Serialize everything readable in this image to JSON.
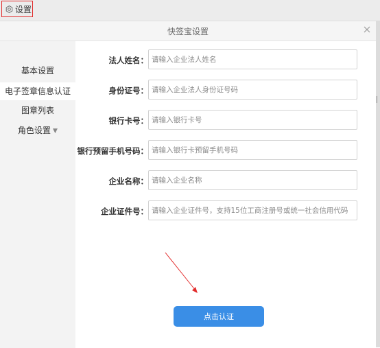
{
  "topbar": {
    "settings_label": "设置"
  },
  "dialog": {
    "title": "快签宝设置"
  },
  "sidebar": {
    "items": [
      {
        "label": "基本设置"
      },
      {
        "label": "电子签章信息认证"
      },
      {
        "label": "图章列表"
      },
      {
        "label": "角色设置"
      }
    ],
    "active_index": 1
  },
  "form": {
    "fields": [
      {
        "label": "法人姓名：",
        "placeholder": "请输入企业法人姓名",
        "value": ""
      },
      {
        "label": "身份证号：",
        "placeholder": "请输入企业法人身份证号码",
        "value": ""
      },
      {
        "label": "银行卡号：",
        "placeholder": "请输入银行卡号",
        "value": ""
      },
      {
        "label": "银行预留手机号码：",
        "placeholder": "请输入银行卡预留手机号码",
        "value": ""
      },
      {
        "label": "企业名称：",
        "placeholder": "请输入企业名称",
        "value": ""
      },
      {
        "label": "企业证件号：",
        "placeholder": "请输入企业证件号，支持15位工商注册号或统一社会信用代码",
        "value": ""
      }
    ],
    "submit_label": "点击认证"
  },
  "colors": {
    "accent": "#3a8ee6",
    "highlight": "#e22a2a",
    "sidebar_bg": "#f3f3f3"
  },
  "icons": {
    "settings": "gear-icon",
    "close": "close-icon",
    "dropdown": "caret-down-icon"
  }
}
